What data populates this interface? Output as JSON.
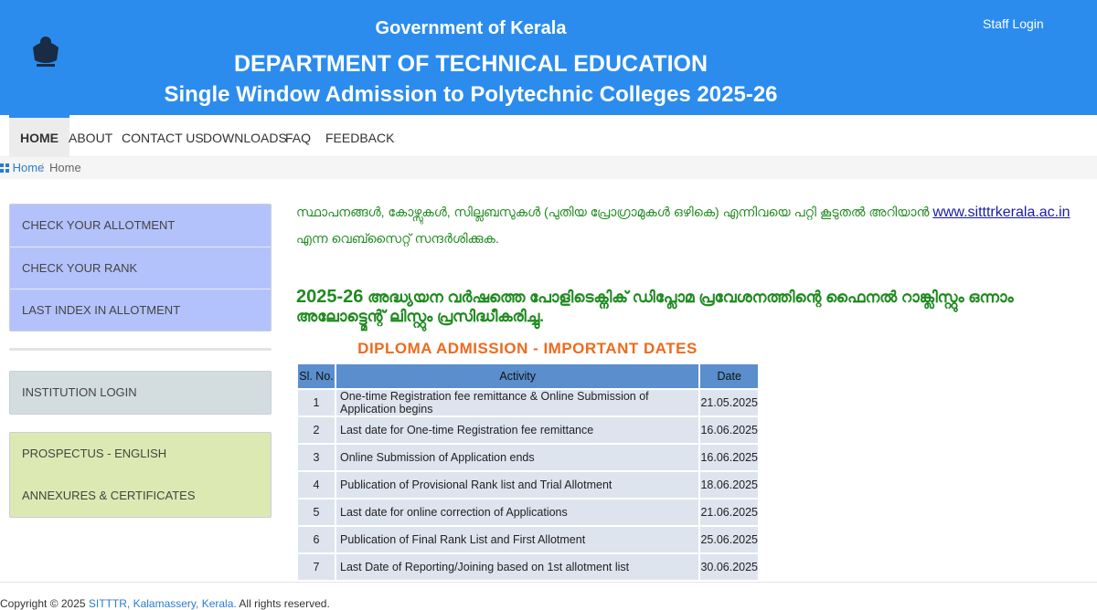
{
  "header": {
    "gov": "Government of Kerala",
    "dept": "DEPARTMENT OF TECHNICAL EDUCATION",
    "title": "Single Window Admission to Polytechnic Colleges 2025-26",
    "staff_login": "Staff Login",
    "bg_color": "#2b8cee"
  },
  "nav": {
    "home": "HOME",
    "about": "ABOUT",
    "contact": "CONTACT US",
    "downloads": "DOWNLOADS",
    "faq": "FAQ",
    "feedback": "FEEDBACK"
  },
  "breadcrumb": {
    "home": "Home",
    "sep": "/",
    "current": "Home"
  },
  "sidebar": {
    "group1": [
      "CHECK YOUR ALLOTMENT",
      "CHECK YOUR RANK",
      "LAST INDEX IN ALLOTMENT"
    ],
    "group2": [
      "INSTITUTION LOGIN"
    ],
    "group3": [
      "PROSPECTUS - ENGLISH",
      "ANNEXURES & CERTIFICATES"
    ]
  },
  "notice": {
    "before": "സ്ഥാപനങ്ങൾ, കോഴ്സുകൾ, സില്ലബസുകൾ (പുതിയ പ്രോഗ്രാമുകൾ ഒഴികെ) എന്നിവയെ പറ്റി കൂടുതൽ അറിയാൻ ",
    "link": "www.sitttrkerala.ac.in",
    "after": " എന്ന വെബ്സൈറ്റ് സന്ദർശിക്കുക.",
    "headline_year": "2025-26",
    "headline_text": " അദ്ധ്യയന വർഷത്തെ പോളിടെക്നിക് ഡിപ്ലോമ പ്രവേശനത്തിന്റെ ഫൈനൽ റാങ്ക്ലിസ്റ്റും ഒന്നാം അലോട്ട്മെന്റ് ലിസ്റ്റും പ്രസിദ്ധീകരിച്ചു."
  },
  "dates": {
    "title": "DIPLOMA ADMISSION - IMPORTANT DATES",
    "headers": [
      "Sl. No.",
      "Activity",
      "Date"
    ],
    "rows": [
      {
        "sl": "1",
        "activity": "One-time Registration fee remittance & Online Submission of Application begins",
        "date": "21.05.2025"
      },
      {
        "sl": "2",
        "activity": "Last date for One-time Registration fee remittance",
        "date": "16.06.2025"
      },
      {
        "sl": "3",
        "activity": "Online Submission of Application ends",
        "date": "16.06.2025"
      },
      {
        "sl": "4",
        "activity": "Publication of Provisional Rank list and Trial Allotment",
        "date": "18.06.2025"
      },
      {
        "sl": "5",
        "activity": "Last date for online correction of Applications",
        "date": "21.06.2025"
      },
      {
        "sl": "6",
        "activity": "Publication of Final Rank List and First Allotment",
        "date": "25.06.2025"
      },
      {
        "sl": "7",
        "activity": "Last Date of Reporting/Joining based on 1st allotment list",
        "date": "30.06.2025"
      }
    ]
  },
  "footer": {
    "prefix": "Copyright © 2025 ",
    "link": "SITTTR, Kalamassery, Kerala.",
    "suffix": " All rights reserved."
  }
}
